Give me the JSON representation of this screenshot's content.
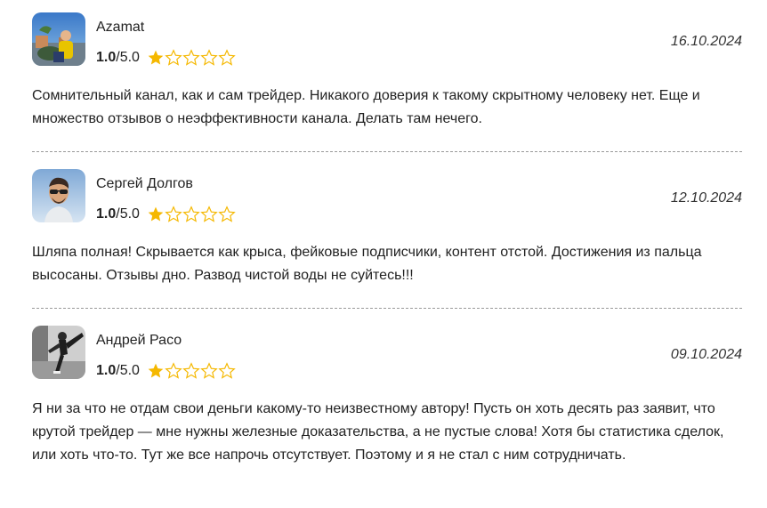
{
  "rating_max_label": "/5.0",
  "colors": {
    "star_filled": "#f5b800",
    "star_empty_stroke": "#f5b800"
  },
  "reviews": [
    {
      "author": "Azamat",
      "score": "1.0",
      "score_max": "/5.0",
      "stars_filled": 1,
      "stars_total": 5,
      "date": "16.10.2024",
      "text": "Сомнительный канал, как и сам трейдер. Никакого доверия к такому скрытному человеку нет. Еще и множество отзывов о неэффективности канала. Делать там нечего.",
      "avatar_icon": "avatar-photo-tourist"
    },
    {
      "author": "Сергей Долгов",
      "score": "1.0",
      "score_max": "/5.0",
      "stars_filled": 1,
      "stars_total": 5,
      "date": "12.10.2024",
      "text": "Шляпа полная! Скрывается как крыса, фейковые подписчики, контент отстой. Достижения из пальца высосаны. Отзывы дно. Развод чистой воды не суйтесь!!!",
      "avatar_icon": "avatar-photo-man-sunglasses"
    },
    {
      "author": "Андрей Расо",
      "score": "1.0",
      "score_max": "/5.0",
      "stars_filled": 1,
      "stars_total": 5,
      "date": "09.10.2024",
      "text": "Я ни за что не отдам свои деньги какому-то неизвестному автору! Пусть он хоть десять раз заявит, что крутой трейдер — мне нужны железные доказательства, а не пустые слова! Хотя бы статистика сделок, или хоть что-то. Тут же все напрочь отсутствует. Поэтому и я не стал с ним сотрудничать.",
      "avatar_icon": "avatar-photo-kick-bw"
    }
  ]
}
